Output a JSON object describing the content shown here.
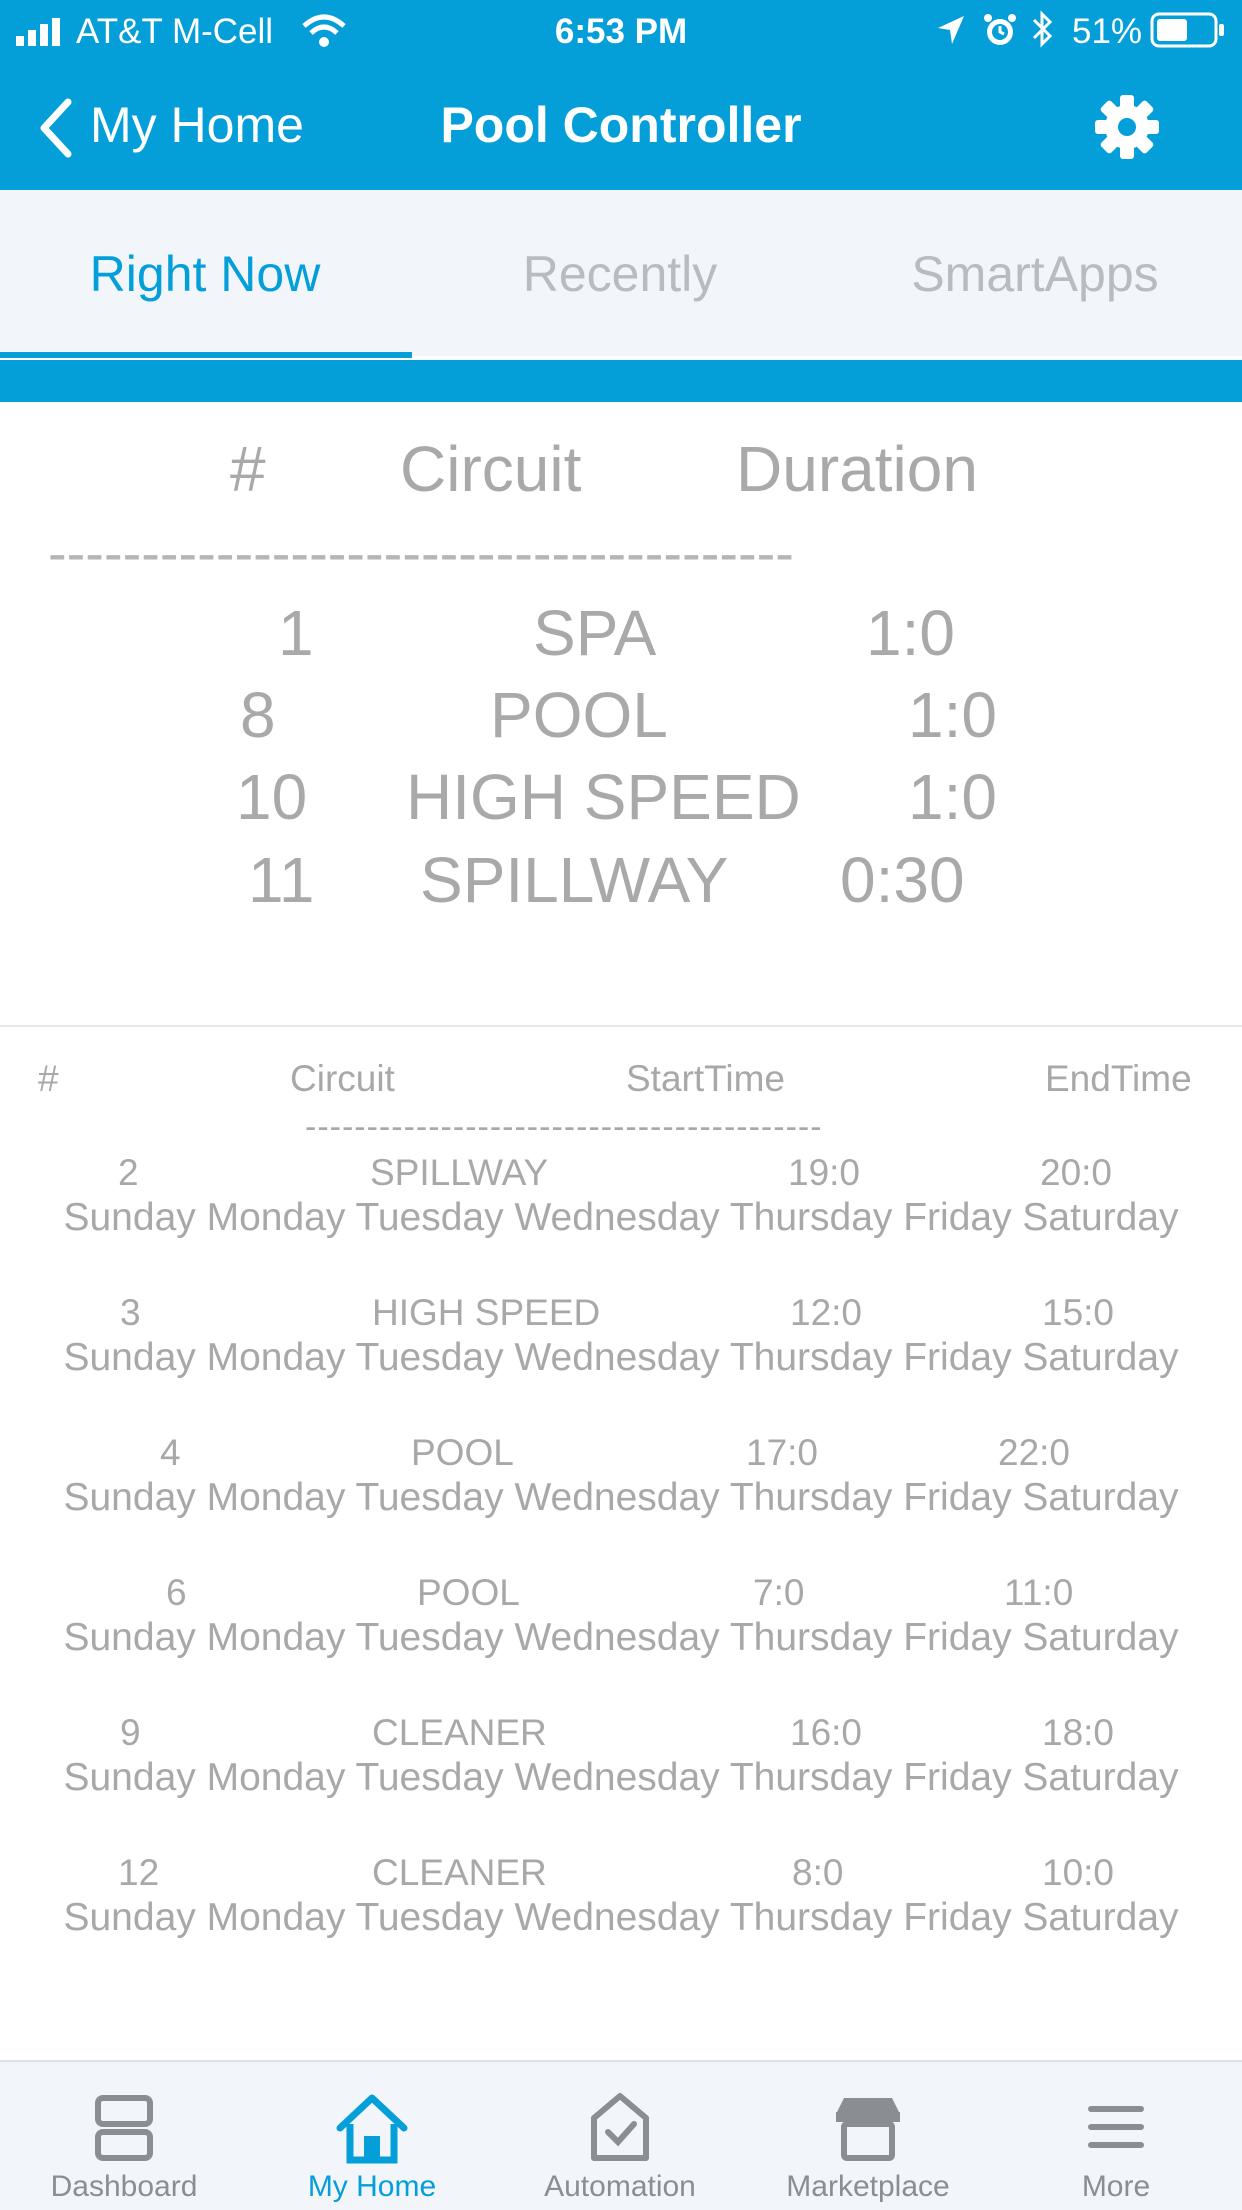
{
  "status_bar": {
    "carrier": "AT&T M-Cell",
    "time": "6:53 PM",
    "battery": "51%"
  },
  "nav": {
    "back_label": "My Home",
    "title": "Pool Controller",
    "settings_icon": "gear-icon"
  },
  "tabs": [
    {
      "label": "Right Now",
      "active": true
    },
    {
      "label": "Recently",
      "active": false
    },
    {
      "label": "SmartApps",
      "active": false
    }
  ],
  "right_now": {
    "headers": {
      "num": "#",
      "circuit": "Circuit",
      "duration": "Duration"
    },
    "divider": "----------------------------------------",
    "rows": [
      {
        "num": "1",
        "circuit": "SPA",
        "duration": "1:0"
      },
      {
        "num": "8",
        "circuit": "POOL",
        "duration": "1:0"
      },
      {
        "num": "10",
        "circuit": "HIGH SPEED",
        "duration": "1:0"
      },
      {
        "num": "11",
        "circuit": "SPILLWAY",
        "duration": "0:30"
      }
    ]
  },
  "schedule": {
    "headers": {
      "num": "#",
      "circuit": "Circuit",
      "start": "StartTime",
      "end": "EndTime"
    },
    "divider": "------------------------------------------",
    "days": "Sunday Monday Tuesday Wednesday Thursday Friday Saturday",
    "rows": [
      {
        "num": "2",
        "circuit": "SPILLWAY",
        "start": "19:0",
        "end": "20:0"
      },
      {
        "num": "3",
        "circuit": "HIGH SPEED",
        "start": "12:0",
        "end": "15:0"
      },
      {
        "num": "4",
        "circuit": "POOL",
        "start": "17:0",
        "end": "22:0"
      },
      {
        "num": "6",
        "circuit": "POOL",
        "start": "7:0",
        "end": "11:0"
      },
      {
        "num": "9",
        "circuit": "CLEANER",
        "start": "16:0",
        "end": "18:0"
      },
      {
        "num": "12",
        "circuit": "CLEANER",
        "start": "8:0",
        "end": "10:0"
      }
    ]
  },
  "bottom_nav": [
    {
      "label": "Dashboard",
      "icon": "dashboard-icon",
      "active": false
    },
    {
      "label": "My Home",
      "icon": "home-icon",
      "active": true
    },
    {
      "label": "Automation",
      "icon": "automation-icon",
      "active": false
    },
    {
      "label": "Marketplace",
      "icon": "marketplace-icon",
      "active": false
    },
    {
      "label": "More",
      "icon": "menu-icon",
      "active": false
    }
  ],
  "colors": {
    "accent": "#049fd9",
    "text_muted": "#a8a8a8"
  }
}
